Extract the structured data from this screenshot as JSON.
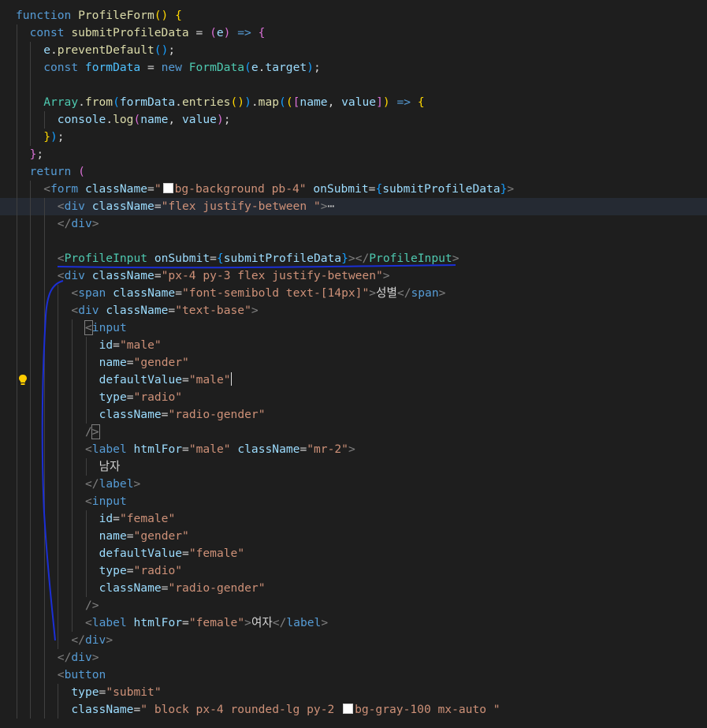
{
  "editor": {
    "lines": [
      {
        "indent": 0,
        "tokens": [
          [
            "k",
            "function"
          ],
          [
            "p",
            " "
          ],
          [
            "f",
            "ProfileForm"
          ],
          [
            "b1",
            "()"
          ],
          [
            "p",
            " "
          ],
          [
            "b1",
            "{"
          ]
        ]
      },
      {
        "indent": 1,
        "tokens": [
          [
            "k",
            "const"
          ],
          [
            "p",
            " "
          ],
          [
            "f",
            "submitProfileData"
          ],
          [
            "p",
            " = "
          ],
          [
            "b2",
            "("
          ],
          [
            "v",
            "e"
          ],
          [
            "b2",
            ")"
          ],
          [
            "p",
            " "
          ],
          [
            "k",
            "=>"
          ],
          [
            "p",
            " "
          ],
          [
            "b2",
            "{"
          ]
        ]
      },
      {
        "indent": 2,
        "tokens": [
          [
            "v",
            "e"
          ],
          [
            "p",
            "."
          ],
          [
            "f",
            "preventDefault"
          ],
          [
            "b3",
            "()"
          ],
          [
            "p",
            ";"
          ]
        ]
      },
      {
        "indent": 2,
        "tokens": [
          [
            "k",
            "const"
          ],
          [
            "p",
            " "
          ],
          [
            "c",
            "formData"
          ],
          [
            "p",
            " = "
          ],
          [
            "k",
            "new"
          ],
          [
            "p",
            " "
          ],
          [
            "t",
            "FormData"
          ],
          [
            "b3",
            "("
          ],
          [
            "v",
            "e"
          ],
          [
            "p",
            "."
          ],
          [
            "v",
            "target"
          ],
          [
            "b3",
            ")"
          ],
          [
            "p",
            ";"
          ]
        ]
      },
      {
        "indent": 0,
        "tokens": []
      },
      {
        "indent": 2,
        "tokens": [
          [
            "t",
            "Array"
          ],
          [
            "p",
            "."
          ],
          [
            "f",
            "from"
          ],
          [
            "b3",
            "("
          ],
          [
            "v",
            "formData"
          ],
          [
            "p",
            "."
          ],
          [
            "f",
            "entries"
          ],
          [
            "b1",
            "()"
          ],
          [
            "b3",
            ")"
          ],
          [
            "p",
            "."
          ],
          [
            "f",
            "map"
          ],
          [
            "b3",
            "("
          ],
          [
            "b1",
            "("
          ],
          [
            "b2",
            "["
          ],
          [
            "v",
            "name"
          ],
          [
            "p",
            ", "
          ],
          [
            "v",
            "value"
          ],
          [
            "b2",
            "]"
          ],
          [
            "b1",
            ")"
          ],
          [
            "p",
            " "
          ],
          [
            "k",
            "=>"
          ],
          [
            "p",
            " "
          ],
          [
            "b1",
            "{"
          ]
        ]
      },
      {
        "indent": 3,
        "tokens": [
          [
            "v",
            "console"
          ],
          [
            "p",
            "."
          ],
          [
            "f",
            "log"
          ],
          [
            "b2",
            "("
          ],
          [
            "v",
            "name"
          ],
          [
            "p",
            ", "
          ],
          [
            "v",
            "value"
          ],
          [
            "b2",
            ")"
          ],
          [
            "p",
            ";"
          ]
        ]
      },
      {
        "indent": 2,
        "tokens": [
          [
            "b1",
            "}"
          ],
          [
            "b3",
            ")"
          ],
          [
            "p",
            ";"
          ]
        ]
      },
      {
        "indent": 1,
        "tokens": [
          [
            "b2",
            "}"
          ],
          [
            "p",
            ";"
          ]
        ]
      },
      {
        "indent": 1,
        "tokens": [
          [
            "k",
            "return"
          ],
          [
            "p",
            " "
          ],
          [
            "b2",
            "("
          ]
        ]
      },
      {
        "indent": 2,
        "tokens": [
          [
            "g",
            "<"
          ],
          [
            "k",
            "form"
          ],
          [
            "p",
            " "
          ],
          [
            "v",
            "className"
          ],
          [
            "p",
            "="
          ],
          [
            "s",
            "\""
          ],
          [
            "swatch",
            ""
          ],
          [
            "s",
            "bg-background pb-4\""
          ],
          [
            "p",
            " "
          ],
          [
            "v",
            "onSubmit"
          ],
          [
            "p",
            "="
          ],
          [
            "b3",
            "{"
          ],
          [
            "v",
            "submitProfileData"
          ],
          [
            "b3",
            "}"
          ],
          [
            "g",
            ">"
          ]
        ]
      },
      {
        "indent": 3,
        "active": true,
        "fold": ">",
        "tokens": [
          [
            "g",
            "<"
          ],
          [
            "k",
            "div"
          ],
          [
            "p",
            " "
          ],
          [
            "v",
            "className"
          ],
          [
            "p",
            "="
          ],
          [
            "s",
            "\"flex justify-between \""
          ],
          [
            "g",
            ">"
          ],
          [
            "ellipsis",
            "⋯"
          ]
        ]
      },
      {
        "indent": 3,
        "tokens": [
          [
            "g",
            "</"
          ],
          [
            "k",
            "div"
          ],
          [
            "g",
            ">"
          ]
        ]
      },
      {
        "indent": 0,
        "tokens": []
      },
      {
        "indent": 3,
        "tokens": [
          [
            "g",
            "<"
          ],
          [
            "t",
            "ProfileInput"
          ],
          [
            "p",
            " "
          ],
          [
            "v",
            "onSubmit"
          ],
          [
            "p",
            "="
          ],
          [
            "b3",
            "{"
          ],
          [
            "v",
            "submitProfileData"
          ],
          [
            "b3",
            "}"
          ],
          [
            "g",
            "></"
          ],
          [
            "t",
            "ProfileInput"
          ],
          [
            "g",
            ">"
          ]
        ]
      },
      {
        "indent": 3,
        "tokens": [
          [
            "g",
            "<"
          ],
          [
            "k",
            "div"
          ],
          [
            "p",
            " "
          ],
          [
            "v",
            "className"
          ],
          [
            "p",
            "="
          ],
          [
            "s",
            "\"px-4 py-3 flex justify-between\""
          ],
          [
            "g",
            ">"
          ]
        ]
      },
      {
        "indent": 4,
        "tokens": [
          [
            "g",
            "<"
          ],
          [
            "k",
            "span"
          ],
          [
            "p",
            " "
          ],
          [
            "v",
            "className"
          ],
          [
            "p",
            "="
          ],
          [
            "s",
            "\"font-semibold text-[14px]\""
          ],
          [
            "g",
            ">"
          ],
          [
            "p",
            "성별"
          ],
          [
            "g",
            "</"
          ],
          [
            "k",
            "span"
          ],
          [
            "g",
            ">"
          ]
        ]
      },
      {
        "indent": 4,
        "tokens": [
          [
            "g",
            "<"
          ],
          [
            "k",
            "div"
          ],
          [
            "p",
            " "
          ],
          [
            "v",
            "className"
          ],
          [
            "p",
            "="
          ],
          [
            "s",
            "\"text-base\""
          ],
          [
            "g",
            ">"
          ]
        ]
      },
      {
        "indent": 5,
        "tokens": [
          [
            "gbox",
            "<"
          ],
          [
            "k",
            "input"
          ]
        ]
      },
      {
        "indent": 6,
        "tokens": [
          [
            "v",
            "id"
          ],
          [
            "p",
            "="
          ],
          [
            "s",
            "\"male\""
          ]
        ]
      },
      {
        "indent": 6,
        "tokens": [
          [
            "v",
            "name"
          ],
          [
            "p",
            "="
          ],
          [
            "s",
            "\"gender\""
          ]
        ]
      },
      {
        "indent": 6,
        "bulb": true,
        "tokens": [
          [
            "v",
            "defaultValue"
          ],
          [
            "p",
            "="
          ],
          [
            "s",
            "\"male\""
          ],
          [
            "cursor",
            ""
          ]
        ]
      },
      {
        "indent": 6,
        "tokens": [
          [
            "v",
            "type"
          ],
          [
            "p",
            "="
          ],
          [
            "s",
            "\"radio\""
          ]
        ]
      },
      {
        "indent": 6,
        "tokens": [
          [
            "v",
            "className"
          ],
          [
            "p",
            "="
          ],
          [
            "s",
            "\"radio-gender\""
          ]
        ]
      },
      {
        "indent": 5,
        "tokens": [
          [
            "g",
            "/"
          ],
          [
            "gbox",
            ">"
          ]
        ]
      },
      {
        "indent": 5,
        "tokens": [
          [
            "g",
            "<"
          ],
          [
            "k",
            "label"
          ],
          [
            "p",
            " "
          ],
          [
            "v",
            "htmlFor"
          ],
          [
            "p",
            "="
          ],
          [
            "s",
            "\"male\""
          ],
          [
            "p",
            " "
          ],
          [
            "v",
            "className"
          ],
          [
            "p",
            "="
          ],
          [
            "s",
            "\"mr-2\""
          ],
          [
            "g",
            ">"
          ]
        ]
      },
      {
        "indent": 6,
        "tokens": [
          [
            "p",
            "남자"
          ]
        ]
      },
      {
        "indent": 5,
        "tokens": [
          [
            "g",
            "</"
          ],
          [
            "k",
            "label"
          ],
          [
            "g",
            ">"
          ]
        ]
      },
      {
        "indent": 5,
        "tokens": [
          [
            "g",
            "<"
          ],
          [
            "k",
            "input"
          ]
        ]
      },
      {
        "indent": 6,
        "tokens": [
          [
            "v",
            "id"
          ],
          [
            "p",
            "="
          ],
          [
            "s",
            "\"female\""
          ]
        ]
      },
      {
        "indent": 6,
        "tokens": [
          [
            "v",
            "name"
          ],
          [
            "p",
            "="
          ],
          [
            "s",
            "\"gender\""
          ]
        ]
      },
      {
        "indent": 6,
        "tokens": [
          [
            "v",
            "defaultValue"
          ],
          [
            "p",
            "="
          ],
          [
            "s",
            "\"female\""
          ]
        ]
      },
      {
        "indent": 6,
        "tokens": [
          [
            "v",
            "type"
          ],
          [
            "p",
            "="
          ],
          [
            "s",
            "\"radio\""
          ]
        ]
      },
      {
        "indent": 6,
        "tokens": [
          [
            "v",
            "className"
          ],
          [
            "p",
            "="
          ],
          [
            "s",
            "\"radio-gender\""
          ]
        ]
      },
      {
        "indent": 5,
        "tokens": [
          [
            "g",
            "/>"
          ]
        ]
      },
      {
        "indent": 5,
        "tokens": [
          [
            "g",
            "<"
          ],
          [
            "k",
            "label"
          ],
          [
            "p",
            " "
          ],
          [
            "v",
            "htmlFor"
          ],
          [
            "p",
            "="
          ],
          [
            "s",
            "\"female\""
          ],
          [
            "g",
            ">"
          ],
          [
            "p",
            "여자"
          ],
          [
            "g",
            "</"
          ],
          [
            "k",
            "label"
          ],
          [
            "g",
            ">"
          ]
        ]
      },
      {
        "indent": 4,
        "tokens": [
          [
            "g",
            "</"
          ],
          [
            "k",
            "div"
          ],
          [
            "g",
            ">"
          ]
        ]
      },
      {
        "indent": 3,
        "tokens": [
          [
            "g",
            "</"
          ],
          [
            "k",
            "div"
          ],
          [
            "g",
            ">"
          ]
        ]
      },
      {
        "indent": 3,
        "tokens": [
          [
            "g",
            "<"
          ],
          [
            "k",
            "button"
          ]
        ]
      },
      {
        "indent": 4,
        "tokens": [
          [
            "v",
            "type"
          ],
          [
            "p",
            "="
          ],
          [
            "s",
            "\"submit\""
          ]
        ]
      },
      {
        "indent": 4,
        "tokens": [
          [
            "v",
            "className"
          ],
          [
            "p",
            "="
          ],
          [
            "s",
            "\" block px-4 rounded-lg py-2 "
          ],
          [
            "swatch",
            ""
          ],
          [
            "s",
            "bg-gray-100 mx-auto \""
          ]
        ]
      }
    ]
  }
}
